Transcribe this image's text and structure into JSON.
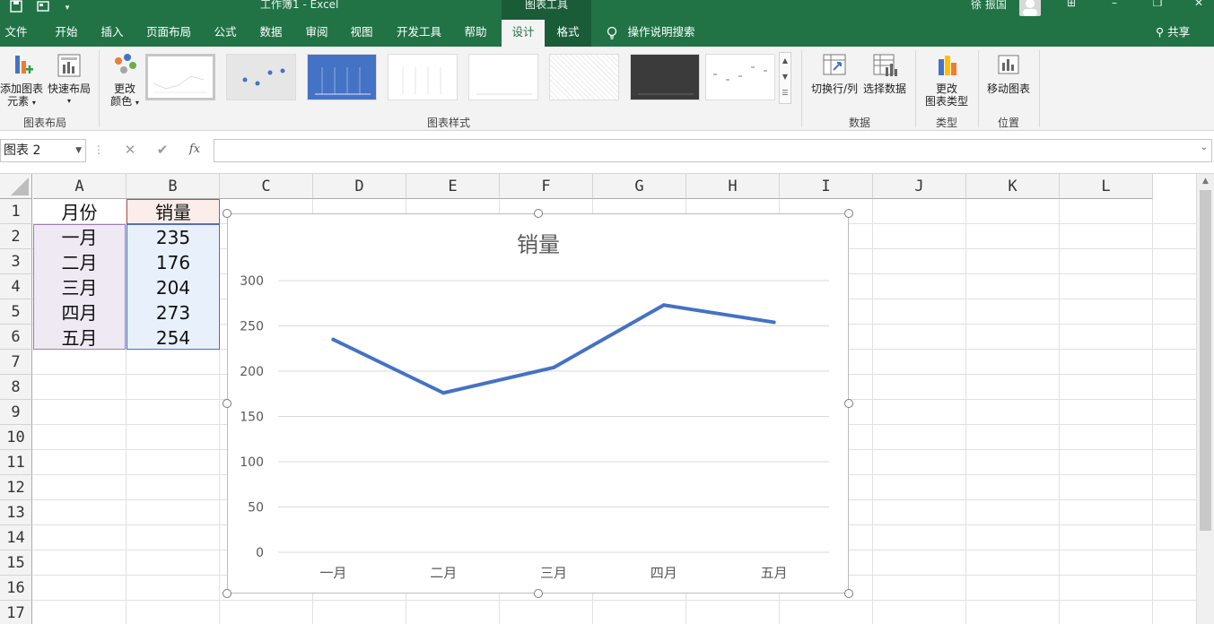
{
  "titlebar": {
    "doc_title": "工作簿1  -  Excel",
    "context_title": "图表工具",
    "user_name": "徐 振国",
    "quick_access": [
      "save-icon",
      "touch-mode-icon",
      "customize-icon"
    ]
  },
  "tabs": [
    {
      "label": "文件"
    },
    {
      "label": "开始"
    },
    {
      "label": "插入"
    },
    {
      "label": "页面布局"
    },
    {
      "label": "公式"
    },
    {
      "label": "数据"
    },
    {
      "label": "审阅"
    },
    {
      "label": "视图"
    },
    {
      "label": "开发工具"
    },
    {
      "label": "帮助"
    },
    {
      "label": "设计"
    },
    {
      "label": "格式"
    },
    {
      "label": "操作说明搜索"
    }
  ],
  "share_label": "共享",
  "ribbon": {
    "add_element": {
      "line1": "添加图表",
      "line2": "元素"
    },
    "quick_layout": "快速布局",
    "group_layout": "图表布局",
    "change_color": {
      "line1": "更改",
      "line2": "颜色"
    },
    "group_styles": "图表样式",
    "switch_row_col": "切换行/列",
    "select_data": "选择数据",
    "group_data": "数据",
    "change_type": {
      "line1": "更改",
      "line2": "图表类型"
    },
    "group_type": "类型",
    "move_chart": "移动图表",
    "group_location": "位置"
  },
  "formula_bar": {
    "name_box": "图表 2",
    "cancel": "✕",
    "enter": "✔",
    "fx": "fx",
    "value": ""
  },
  "columns": [
    "A",
    "B",
    "C",
    "D",
    "E",
    "F",
    "G",
    "H",
    "I",
    "J",
    "K",
    "L"
  ],
  "rows": [
    "1",
    "2",
    "3",
    "4",
    "5",
    "6",
    "7",
    "8",
    "9",
    "10",
    "11",
    "12",
    "13",
    "14",
    "15",
    "16",
    "17"
  ],
  "cells": {
    "A1": "月份",
    "B1": "销量",
    "A2": "一月",
    "B2": "235",
    "A3": "二月",
    "B3": "176",
    "A4": "三月",
    "B4": "204",
    "A5": "四月",
    "B5": "273",
    "A6": "五月",
    "B6": "254"
  },
  "colors": {
    "excel_green": "#217346",
    "series_line": "#4472c4",
    "month_range_fill": "#efe9f3",
    "sales_range_fill": "#e8f0fb"
  },
  "chart_data": {
    "type": "line",
    "title": "销量",
    "categories": [
      "一月",
      "二月",
      "三月",
      "四月",
      "五月"
    ],
    "series": [
      {
        "values": [
          235,
          176,
          204,
          273,
          254
        ]
      }
    ],
    "ylim": [
      0,
      300
    ],
    "yticks": [
      "300",
      "250",
      "200",
      "150",
      "100",
      "50",
      "0"
    ],
    "grid": true,
    "legend": "none"
  }
}
